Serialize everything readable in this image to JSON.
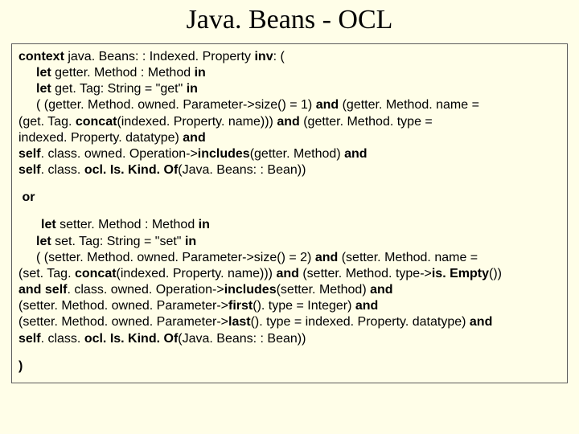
{
  "title": "Java. Beans - OCL",
  "block": {
    "l1_a": "context",
    "l1_b": " java. Beans: : Indexed. Property ",
    "l1_c": "inv",
    "l1_d": ": (",
    "l2_a": "let",
    "l2_b": " getter. Method : Method ",
    "l2_c": "in",
    "l3_a": "let",
    "l3_b": " get. Tag: String = \"get\"   ",
    "l3_c": "in",
    "l4_a": " ( (getter. Method. owned. Parameter->size() = 1) ",
    "l4_b": "and",
    "l4_c": " (getter. Method. name =",
    "l5_a": "(get. Tag. ",
    "l5_b": "concat",
    "l5_c": "(indexed. Property. name))) ",
    "l5_d": "and",
    "l5_e": " (getter. Method. type =",
    "l6_a": "indexed. Property. datatype) ",
    "l6_b": "and",
    "l7_a": "self",
    "l7_b": ". class. owned. Operation->",
    "l7_c": "includes",
    "l7_d": "(getter. Method) ",
    "l7_e": "and",
    "l8_a": "self",
    "l8_b": ". class. ",
    "l8_c": "ocl. Is. Kind. Of",
    "l8_d": "(Java. Beans: : Bean))",
    "or": "or",
    "s2_a": "let",
    "s2_b": " setter. Method : Method ",
    "s2_c": "in",
    "s3_a": "let",
    "s3_b": " set. Tag: String = \"set\"   ",
    "s3_c": "in",
    "s4_a": " ( (setter. Method. owned. Parameter->size() = 2) ",
    "s4_b": "and",
    "s4_c": " (setter. Method. name =",
    "s5_a": "(set. Tag. ",
    "s5_b": "concat",
    "s5_c": "(indexed. Property. name))) ",
    "s5_d": "and",
    "s5_e": " (setter. Method. type->",
    "s5_f": "is. Empty",
    "s5_g": "())",
    "s6_a": "and self",
    "s6_b": ". class. owned. Operation->",
    "s6_c": "includes",
    "s6_d": "(setter. Method) ",
    "s6_e": "and",
    "s7_a": "(setter. Method. owned. Parameter->",
    "s7_b": "first",
    "s7_c": "(). type = Integer) ",
    "s7_d": "and",
    "s8_a": "(setter. Method. owned. Parameter->",
    "s8_b": "last",
    "s8_c": "(). type = indexed. Property. datatype) ",
    "s8_d": "and",
    "s9_a": "self",
    "s9_b": ". class. ",
    "s9_c": "ocl. Is. Kind. Of",
    "s9_d": "(Java. Beans: : Bean))",
    "close": ")"
  }
}
